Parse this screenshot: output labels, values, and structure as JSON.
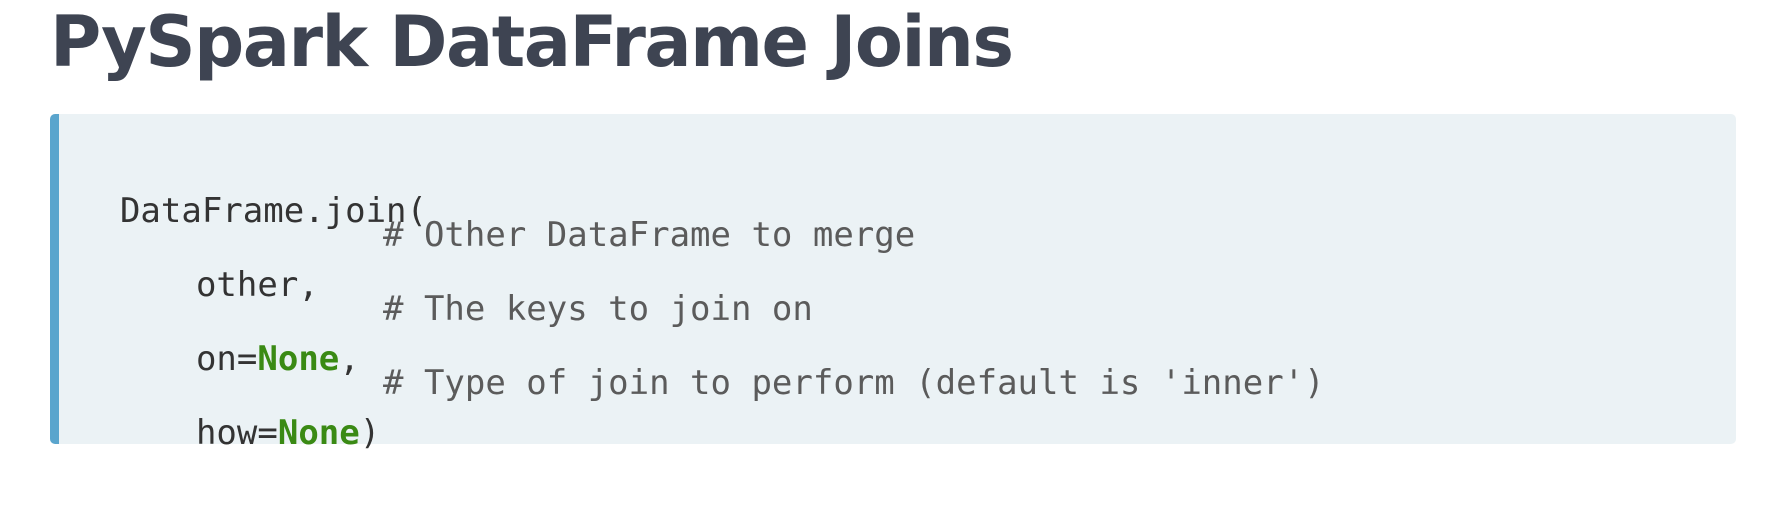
{
  "title": "PySpark DataFrame Joins",
  "code": {
    "line_0": "DataFrame.join(",
    "line_1": {
      "pre": "other,",
      "comment": "# Other DataFrame to merge"
    },
    "line_2": {
      "pre": "on=",
      "keyword": "None",
      "post": ",",
      "comment": "# The keys to join on"
    },
    "line_3": {
      "pre": "how=",
      "keyword": "None",
      "post": ")",
      "comment": "# Type of join to perform (default is 'inner')"
    }
  },
  "colors": {
    "title": "#3e4452",
    "code_background": "#ebf2f5",
    "code_border": "#5aa5cd",
    "keyword": "#3a8a14"
  }
}
